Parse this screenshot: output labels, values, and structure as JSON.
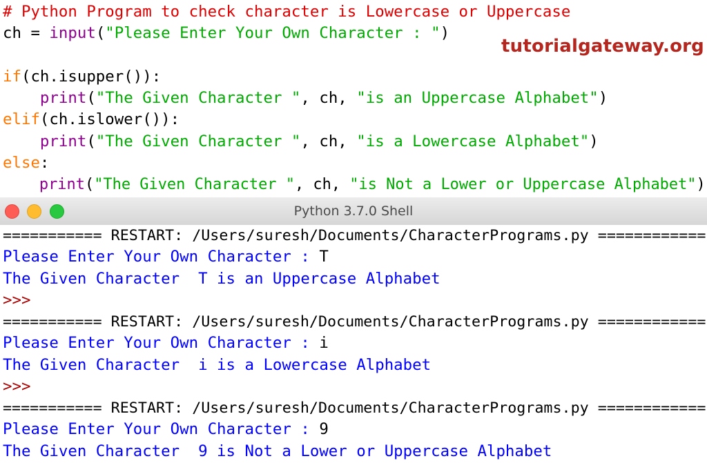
{
  "editor": {
    "lines": [
      {
        "comment": "# Python Program to check character is Lowercase or Uppercase"
      },
      {
        "var": "ch = ",
        "fn": "input",
        "open": "(",
        "str": "\"Please Enter Your Own Character : \"",
        "close": ")"
      },
      {},
      {
        "kw": "if",
        "rest": "(ch.isupper()):"
      },
      {
        "indent": "    ",
        "fn": "print",
        "open": "(",
        "str1": "\"The Given Character \"",
        "mid": ", ch, ",
        "str2": "\"is an Uppercase Alphabet\"",
        "close": ")"
      },
      {
        "kw": "elif",
        "rest": "(ch.islower()):"
      },
      {
        "indent": "    ",
        "fn": "print",
        "open": "(",
        "str1": "\"The Given Character \"",
        "mid": ", ch, ",
        "str2": "\"is a Lowercase Alphabet\"",
        "close": ")"
      },
      {
        "kw": "else",
        "rest": ":"
      },
      {
        "indent": "    ",
        "fn": "print",
        "open": "(",
        "str1": "\"The Given Character \"",
        "mid": ", ch, ",
        "str2": "\"is Not a Lower or Uppercase Alphabet\"",
        "close": ")"
      }
    ]
  },
  "watermark": "tutorialgateway.org",
  "window": {
    "title": "Python 3.7.0 Shell"
  },
  "shell": {
    "restart": "=========== RESTART: /Users/suresh/Documents/CharacterPrograms.py ============",
    "prompt_text": "Please Enter Your Own Character : ",
    "prompt_symbol": ">>>",
    "runs": [
      {
        "input": "T",
        "output": "The Given Character  T is an Uppercase Alphabet"
      },
      {
        "input": "i",
        "output": "The Given Character  i is a Lowercase Alphabet"
      },
      {
        "input": "9",
        "output": "The Given Character  9 is Not a Lower or Uppercase Alphabet"
      }
    ]
  },
  "colors": {
    "keyword": "#ff7700",
    "builtin": "#900090",
    "string": "#00aa00",
    "comment": "#dd0000",
    "shell_output": "#0000ff",
    "shell_prompt": "#aa0000",
    "watermark": "#b5261e"
  }
}
